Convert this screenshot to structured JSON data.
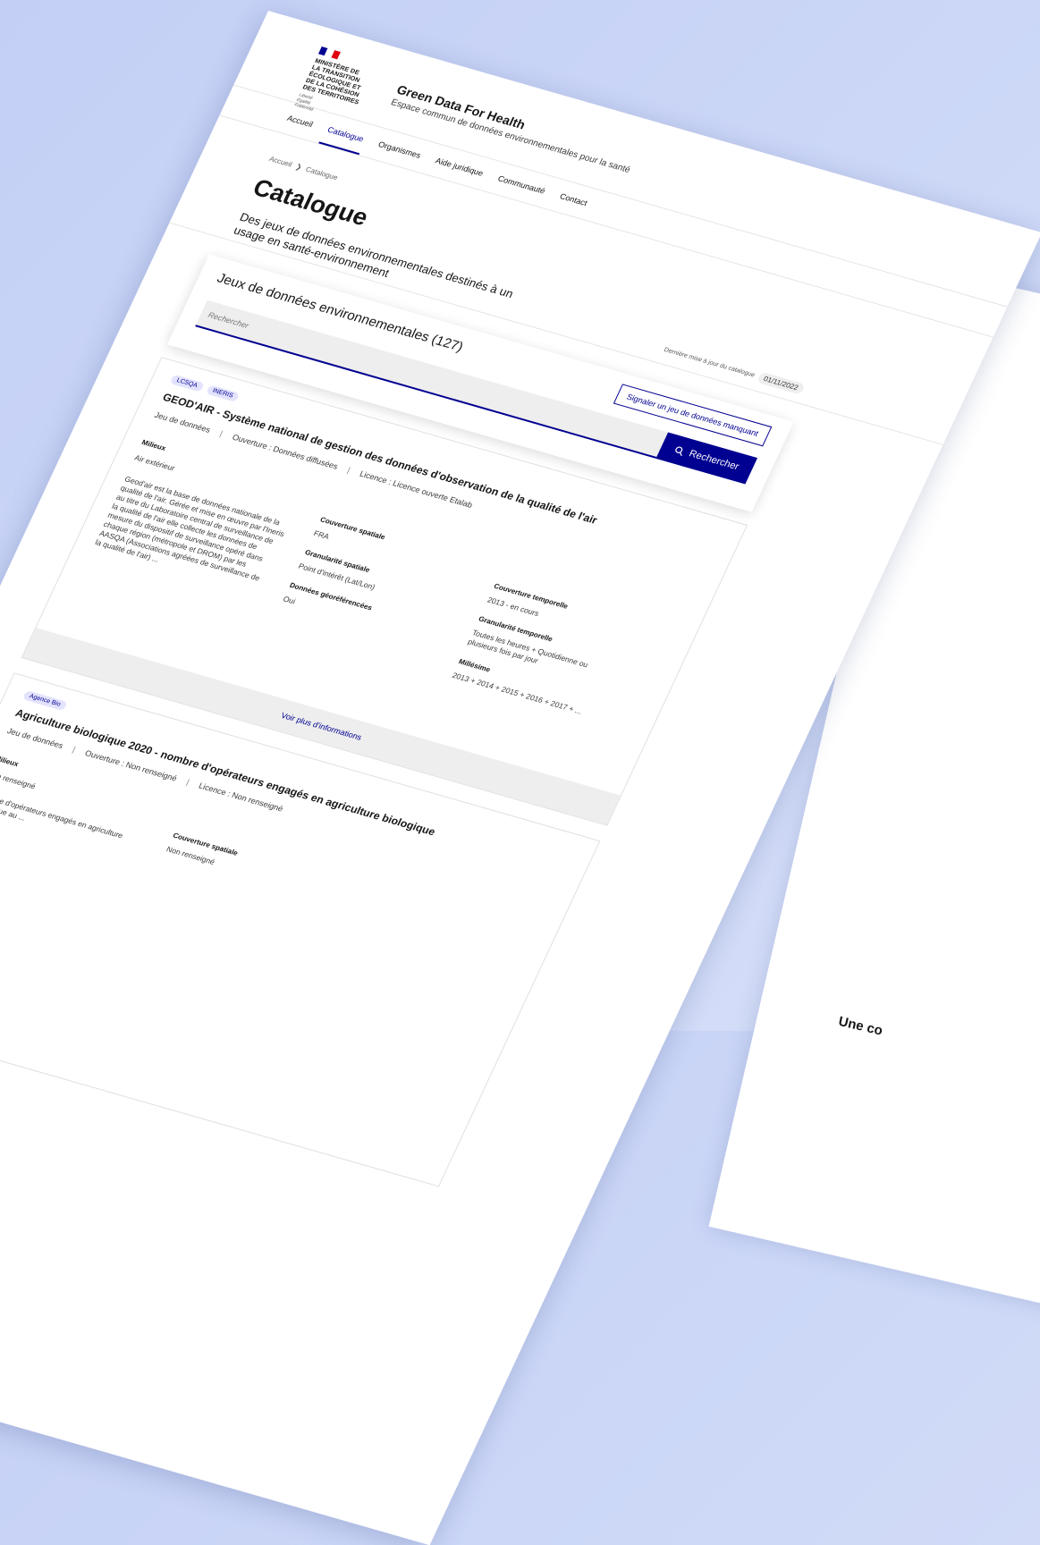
{
  "header": {
    "logo_lines": [
      "Ministère de",
      "la transition",
      "écologique et",
      "de la cohésion",
      "des territoires"
    ],
    "logo_motto": [
      "Liberté",
      "Égalité",
      "Fraternité"
    ],
    "flag_colors": [
      "#000091",
      "#ffffff",
      "#e1000f"
    ],
    "site_title": "Green Data For Health",
    "site_subtitle": "Espace commun de données environnementales pour la santé"
  },
  "nav": [
    {
      "label": "Accueil",
      "active": false
    },
    {
      "label": "Catalogue",
      "active": true
    },
    {
      "label": "Organismes",
      "active": false
    },
    {
      "label": "Aide juridique",
      "active": false
    },
    {
      "label": "Communauté",
      "active": false
    },
    {
      "label": "Contact",
      "active": false
    }
  ],
  "breadcrumb": {
    "home": "Accueil",
    "current": "Catalogue"
  },
  "page": {
    "title": "Catalogue",
    "lead": "Des jeux de données environnementales destinés à un usage en santé-environnement",
    "last_update_label": "Dernière mise à jour du catalogue",
    "last_update_date": "01/11/2022"
  },
  "search": {
    "title": "Jeux de données environnementales (127)",
    "signal_button": "Signaler un jeu de données manquant",
    "placeholder": "Rechercher",
    "button_label": "Rechercher"
  },
  "datasets": [
    {
      "tags": [
        "LCSQA",
        "INERIS"
      ],
      "title": "GEOD'AIR - Système national de gestion des données d'observation de la qualité de l'air",
      "type": "Jeu de données",
      "ouverture": "Ouverture : Données diffusées",
      "licence": "Licence : Licence ouverte Etalab",
      "milieux_label": "Milieux",
      "milieux": "Air extérieur",
      "description": "Geod'air est la base de données nationale de la qualité de l'air. Gérée et mise en œuvre par l'Ineris au titre du Laboratoire central de surveillance de la qualité de l'air elle collecte les données de mesure du dispositif de surveillance opéré dans chaque région (métropole et DROM) par les AASQA (Associations agréées de surveillance de la qualité de l'air) ...",
      "couverture_spatiale_label": "Couverture spatiale",
      "couverture_spatiale": "FRA",
      "granularite_spatiale_label": "Granularité spatiale",
      "granularite_spatiale": "Point d'intérêt (Lat/Lon)",
      "georef_label": "Données géoréférencées",
      "georef": "Oui",
      "couverture_temporelle_label": "Couverture temporelle",
      "couverture_temporelle": "2013 - en cours",
      "granularite_temporelle_label": "Granularité temporelle",
      "granularite_temporelle": "Toutes les heures + Quotidienne ou plusieurs fois par jour",
      "millesime_label": "Millésime",
      "millesime": "2013 + 2014 + 2015 + 2016 + 2017 + ...",
      "more_label": "Voir plus d'informations"
    },
    {
      "tags": [
        "Agence Bio"
      ],
      "title": "Agriculture biologique 2020 - nombre d'opérateurs engagés en agriculture biologique",
      "type": "Jeu de données",
      "ouverture": "Ouverture : Non renseigné",
      "licence": "Licence : Non renseigné",
      "milieux_label": "Milieux",
      "milieux": "Non renseigné",
      "description": "Nombre d'opérateurs engagés en agriculture biologique au ...",
      "couverture_spatiale_label": "Couverture spatiale",
      "couverture_spatiale": "Non renseigné"
    }
  ],
  "back_sheet": {
    "peek_text": "Une co"
  }
}
